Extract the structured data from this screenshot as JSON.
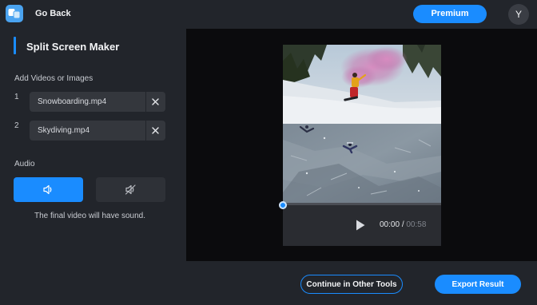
{
  "header": {
    "go_back_label": "Go Back",
    "premium_label": "Premium",
    "avatar_initial": "Y"
  },
  "sidebar": {
    "title": "Split Screen Maker",
    "add_media_label": "Add Videos or Images",
    "files": [
      {
        "index": "1",
        "name": "Snowboarding.mp4"
      },
      {
        "index": "2",
        "name": "Skydiving.mp4"
      }
    ],
    "audio_label": "Audio",
    "audio_note": "The final video will have sound.",
    "audio_selected": "sound-on"
  },
  "player": {
    "current_time": "00:00",
    "separator": "/",
    "duration": "00:58",
    "progress": 0.0
  },
  "footer": {
    "continue_label": "Continue in Other Tools",
    "export_label": "Export Result"
  },
  "colors": {
    "accent": "#1a8cff",
    "panel": "#22252b",
    "stage": "#0b0b0d"
  },
  "icons": {
    "logo": "app-logo-icon",
    "remove": "close-icon",
    "sound_on": "speaker-icon",
    "sound_off": "speaker-muted-icon",
    "play": "play-icon"
  }
}
